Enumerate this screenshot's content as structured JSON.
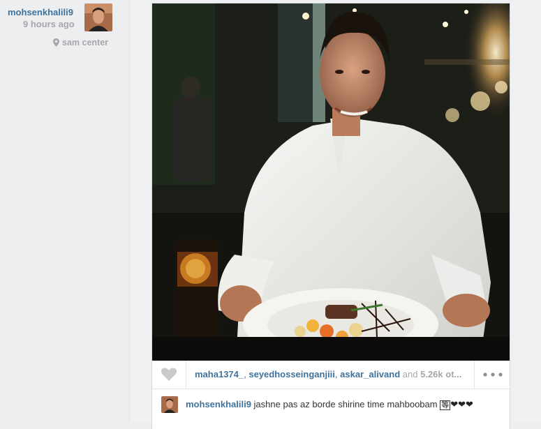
{
  "author": {
    "username": "mohsenkhalili9",
    "time_ago": "9 hours ago",
    "location": "sam center",
    "location_icon": "map-pin-icon",
    "avatar_icon": "avatar"
  },
  "post": {
    "photo_alt": "photo of man in white shirt at dinner table",
    "likes": {
      "users": [
        "maha1374_",
        "seyedhosseinganjiii",
        "askar_alivand"
      ],
      "and_text": "and",
      "count_text": "5.26k ot...",
      "heart_icon": "heart-icon",
      "more_icon": "more-options-icon"
    },
    "caption": {
      "username": "mohsenkhalili9",
      "text": "jashne pas az borde shirine time mahboobam",
      "emoji_box": "等",
      "hearts": "❤❤❤"
    }
  }
}
